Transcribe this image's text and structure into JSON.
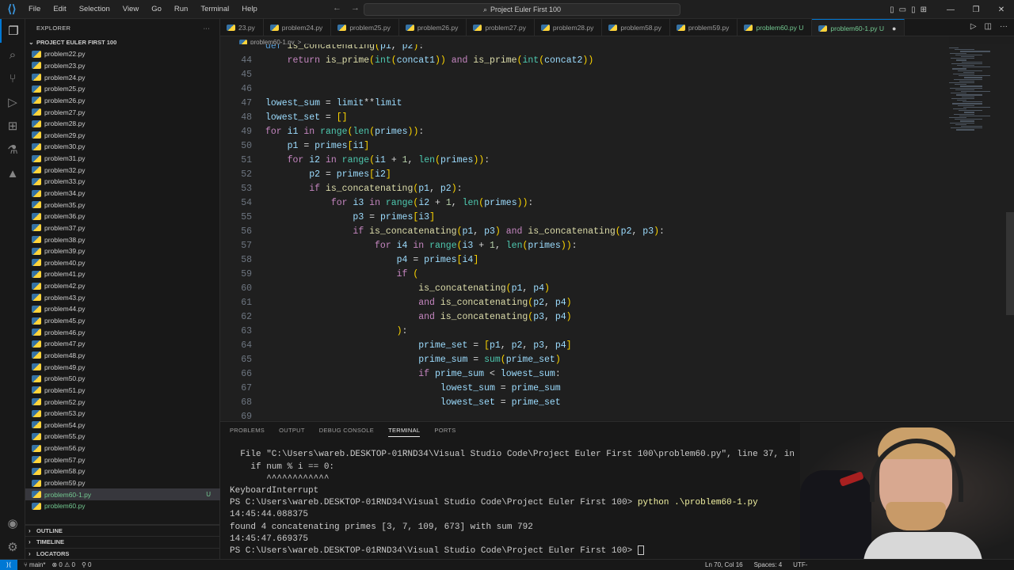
{
  "window": {
    "menu": [
      "File",
      "Edit",
      "Selection",
      "View",
      "Go",
      "Run",
      "Terminal",
      "Help"
    ],
    "search_text": "Project Euler First 100"
  },
  "sidebar": {
    "header": "EXPLORER",
    "project": "PROJECT EULER FIRST 100",
    "files": [
      {
        "name": "problem22.py"
      },
      {
        "name": "problem23.py"
      },
      {
        "name": "problem24.py"
      },
      {
        "name": "problem25.py"
      },
      {
        "name": "problem26.py"
      },
      {
        "name": "problem27.py"
      },
      {
        "name": "problem28.py"
      },
      {
        "name": "problem29.py"
      },
      {
        "name": "problem30.py"
      },
      {
        "name": "problem31.py"
      },
      {
        "name": "problem32.py"
      },
      {
        "name": "problem33.py"
      },
      {
        "name": "problem34.py"
      },
      {
        "name": "problem35.py"
      },
      {
        "name": "problem36.py"
      },
      {
        "name": "problem37.py"
      },
      {
        "name": "problem38.py"
      },
      {
        "name": "problem39.py"
      },
      {
        "name": "problem40.py"
      },
      {
        "name": "problem41.py"
      },
      {
        "name": "problem42.py"
      },
      {
        "name": "problem43.py"
      },
      {
        "name": "problem44.py"
      },
      {
        "name": "problem45.py"
      },
      {
        "name": "problem46.py"
      },
      {
        "name": "problem47.py"
      },
      {
        "name": "problem48.py"
      },
      {
        "name": "problem49.py"
      },
      {
        "name": "problem50.py"
      },
      {
        "name": "problem51.py"
      },
      {
        "name": "problem52.py"
      },
      {
        "name": "problem53.py"
      },
      {
        "name": "problem54.py"
      },
      {
        "name": "problem55.py"
      },
      {
        "name": "problem56.py"
      },
      {
        "name": "problem57.py"
      },
      {
        "name": "problem58.py"
      },
      {
        "name": "problem59.py"
      },
      {
        "name": "problem60-1.py",
        "status": "U",
        "selected": true,
        "modified": true
      },
      {
        "name": "problem60.py",
        "modified": true
      }
    ],
    "sections": [
      "OUTLINE",
      "TIMELINE",
      "LOCATORS"
    ]
  },
  "tabs": [
    {
      "label": "23.py"
    },
    {
      "label": "problem24.py"
    },
    {
      "label": "problem25.py"
    },
    {
      "label": "problem26.py"
    },
    {
      "label": "problem27.py"
    },
    {
      "label": "problem28.py"
    },
    {
      "label": "problem58.py"
    },
    {
      "label": "problem59.py"
    },
    {
      "label": "problem60.py U",
      "modified": true
    },
    {
      "label": "problem60-1.py U",
      "active": true
    }
  ],
  "breadcrumb": [
    "problem60-1.py",
    ">",
    "..."
  ],
  "editor": {
    "lines": [
      {
        "n": "",
        "code": "def is_concatenating(p1, p2):"
      },
      {
        "n": "44",
        "code": "    return is_prime(int(concat1)) and is_prime(int(concat2))"
      },
      {
        "n": "45",
        "code": ""
      },
      {
        "n": "46",
        "code": ""
      },
      {
        "n": "47",
        "code": "lowest_sum = limit**limit"
      },
      {
        "n": "48",
        "code": "lowest_set = []"
      },
      {
        "n": "49",
        "code": "for i1 in range(len(primes)):"
      },
      {
        "n": "50",
        "code": "    p1 = primes[i1]"
      },
      {
        "n": "51",
        "code": "    for i2 in range(i1 + 1, len(primes)):"
      },
      {
        "n": "52",
        "code": "        p2 = primes[i2]"
      },
      {
        "n": "53",
        "code": "        if is_concatenating(p1, p2):"
      },
      {
        "n": "54",
        "code": "            for i3 in range(i2 + 1, len(primes)):"
      },
      {
        "n": "55",
        "code": "                p3 = primes[i3]"
      },
      {
        "n": "56",
        "code": "                if is_concatenating(p1, p3) and is_concatenating(p2, p3):"
      },
      {
        "n": "57",
        "code": "                    for i4 in range(i3 + 1, len(primes)):"
      },
      {
        "n": "58",
        "code": "                        p4 = primes[i4]"
      },
      {
        "n": "59",
        "code": "                        if ("
      },
      {
        "n": "60",
        "code": "                            is_concatenating(p1, p4)"
      },
      {
        "n": "61",
        "code": "                            and is_concatenating(p2, p4)"
      },
      {
        "n": "62",
        "code": "                            and is_concatenating(p3, p4)"
      },
      {
        "n": "63",
        "code": "                        ):"
      },
      {
        "n": "64",
        "code": "                            prime_set = [p1, p2, p3, p4]"
      },
      {
        "n": "65",
        "code": "                            prime_sum = sum(prime_set)"
      },
      {
        "n": "66",
        "code": "                            if prime_sum < lowest_sum:"
      },
      {
        "n": "67",
        "code": "                                lowest_sum = prime_sum"
      },
      {
        "n": "68",
        "code": "                                lowest_set = prime_set"
      },
      {
        "n": "69",
        "code": ""
      }
    ]
  },
  "panel": {
    "tabs": [
      "PROBLEMS",
      "OUTPUT",
      "DEBUG CONSOLE",
      "TERMINAL",
      "PORTS"
    ],
    "active_tab": "TERMINAL",
    "terminal": [
      "  File \"C:\\Users\\wareb.DESKTOP-01RND34\\Visual Studio Code\\Project Euler First 100\\problem60.py\", line 37, in",
      "    if num % i == 0:",
      "       ^^^^^^^^^^^^",
      "KeyboardInterrupt",
      "PS C:\\Users\\wareb.DESKTOP-01RND34\\Visual Studio Code\\Project Euler First 100> ",
      "14:45:44.088375",
      "found 4 concatenating primes [3, 7, 109, 673] with sum 792",
      "14:45:47.669375",
      "PS C:\\Users\\wareb.DESKTOP-01RND34\\Visual Studio Code\\Project Euler First 100> "
    ],
    "command": "python .\\problem60-1.py"
  },
  "statusbar": {
    "branch": "main*",
    "errors": "0",
    "warnings": "0",
    "ports": "0",
    "position": "Ln 70, Col 16",
    "spaces": "Spaces: 4",
    "encoding": "UTF-"
  }
}
